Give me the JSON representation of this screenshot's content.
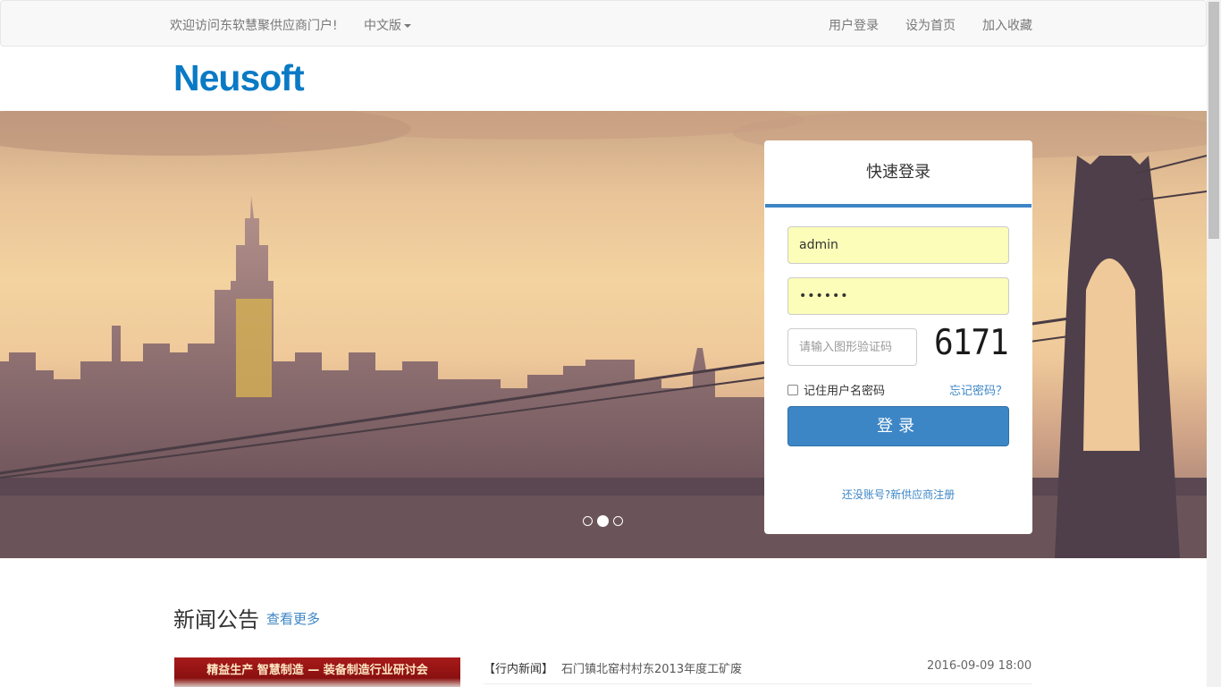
{
  "topbar": {
    "welcome": "欢迎访问东软慧聚供应商门户!",
    "language": "中文版",
    "login": "用户登录",
    "set_home": "设为首页",
    "bookmark": "加入收藏"
  },
  "logo": {
    "text": "Neusoft",
    "color": "#0a7ac5"
  },
  "carousel": {
    "slides": 3,
    "active_index": 1
  },
  "login_panel": {
    "title": "快速登录",
    "username_value": "admin",
    "password_value": "••••••",
    "captcha_placeholder": "请输入图形验证码",
    "captcha_code": "6171",
    "remember_label": "记住用户名密码",
    "forgot_label": "忘记密码？",
    "submit_label": "登录",
    "register_label": "还没账号?新供应商注册",
    "accent_color": "#3d86c6"
  },
  "news": {
    "title": "新闻公告",
    "more": "查看更多",
    "image_caption": "精益生产 智慧制造 — 装备制造行业研讨会",
    "items": [
      {
        "category": "【行内新闻】",
        "text": "石门镇北窑村村东2013年度工矿废",
        "date": "2016-09-09 18:00"
      }
    ]
  }
}
